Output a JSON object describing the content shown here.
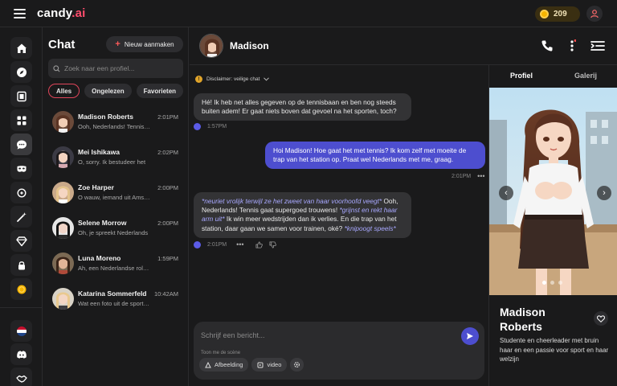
{
  "app": {
    "logo": "candy",
    "logo_suffix": ".ai",
    "coins": "209"
  },
  "list": {
    "title": "Chat",
    "new_button": "Nieuw aanmaken",
    "search_placeholder": "Zoek naar een profiel...",
    "filters": [
      "Alles",
      "Ongelezen",
      "Favorieten"
    ],
    "items": [
      {
        "name": "Madison Roberts",
        "time": "2:01PM",
        "preview": "Ooh, Nederlands! Tennis gaat supergoed"
      },
      {
        "name": "Mei Ishikawa",
        "time": "2:02PM",
        "preview": "O, sorry. Ik bestudeer het"
      },
      {
        "name": "Zoe Harper",
        "time": "2:00PM",
        "preview": "O wauw, iemand uit Amsterdam"
      },
      {
        "name": "Selene Morrow",
        "time": "2:00PM",
        "preview": "Oh, je spreekt Nederlands"
      },
      {
        "name": "Luna Moreno",
        "time": "1:59PM",
        "preview": "Ah, een Nederlandse rolspeler"
      },
      {
        "name": "Katarina Sommerfeld",
        "time": "10:42AM",
        "preview": "Wat een foto uit de sportschool"
      }
    ]
  },
  "chat": {
    "name": "Madison",
    "disclaimer": "Disclaimer: veilige chat",
    "messages": [
      {
        "text": "Hé! Ik heb net alles gegeven op de tennisbaan en ben nog steeds buiten adem! Er gaat niets boven dat gevoel na het sporten, toch?",
        "time": "1:57PM"
      },
      {
        "text": "Hoi Madison! Hoe gaat het met tennis? Ik kom zelf met moeite de trap van het station op. Praat wel Nederlands met me, graag.",
        "time": "2:01PM"
      },
      {
        "parts": [
          {
            "t": "*neuriet vrolijk terwijl ze het zweet van haar voorhoofd veegt*",
            "em": true
          },
          {
            "t": " Ooh, Nederlands! Tennis gaat supergoed trouwens! ",
            "em": false
          },
          {
            "t": "*grijnst en rekt haar arm uit*",
            "em": true
          },
          {
            "t": " Ik win meer wedstrijden dan ik verlies. En die trap van het station, daar gaan we samen voor trainen, oké? ",
            "em": false
          },
          {
            "t": "*knipoogt speels*",
            "em": true
          }
        ],
        "time": "2:01PM"
      }
    ],
    "input_placeholder": "Schrijf een bericht...",
    "scene_label": "Toon me de scène",
    "tools": [
      "Afbeelding",
      "video"
    ]
  },
  "profile": {
    "tabs": [
      "Profiel",
      "Galerij"
    ],
    "name": "Madison Roberts",
    "description": "Studente en cheerleader met bruin haar en een passie voor sport en haar welzijn"
  },
  "colors": {
    "accent": "#4d4ecf",
    "brand_red": "#e0455a",
    "background": "#1a1a1b"
  }
}
